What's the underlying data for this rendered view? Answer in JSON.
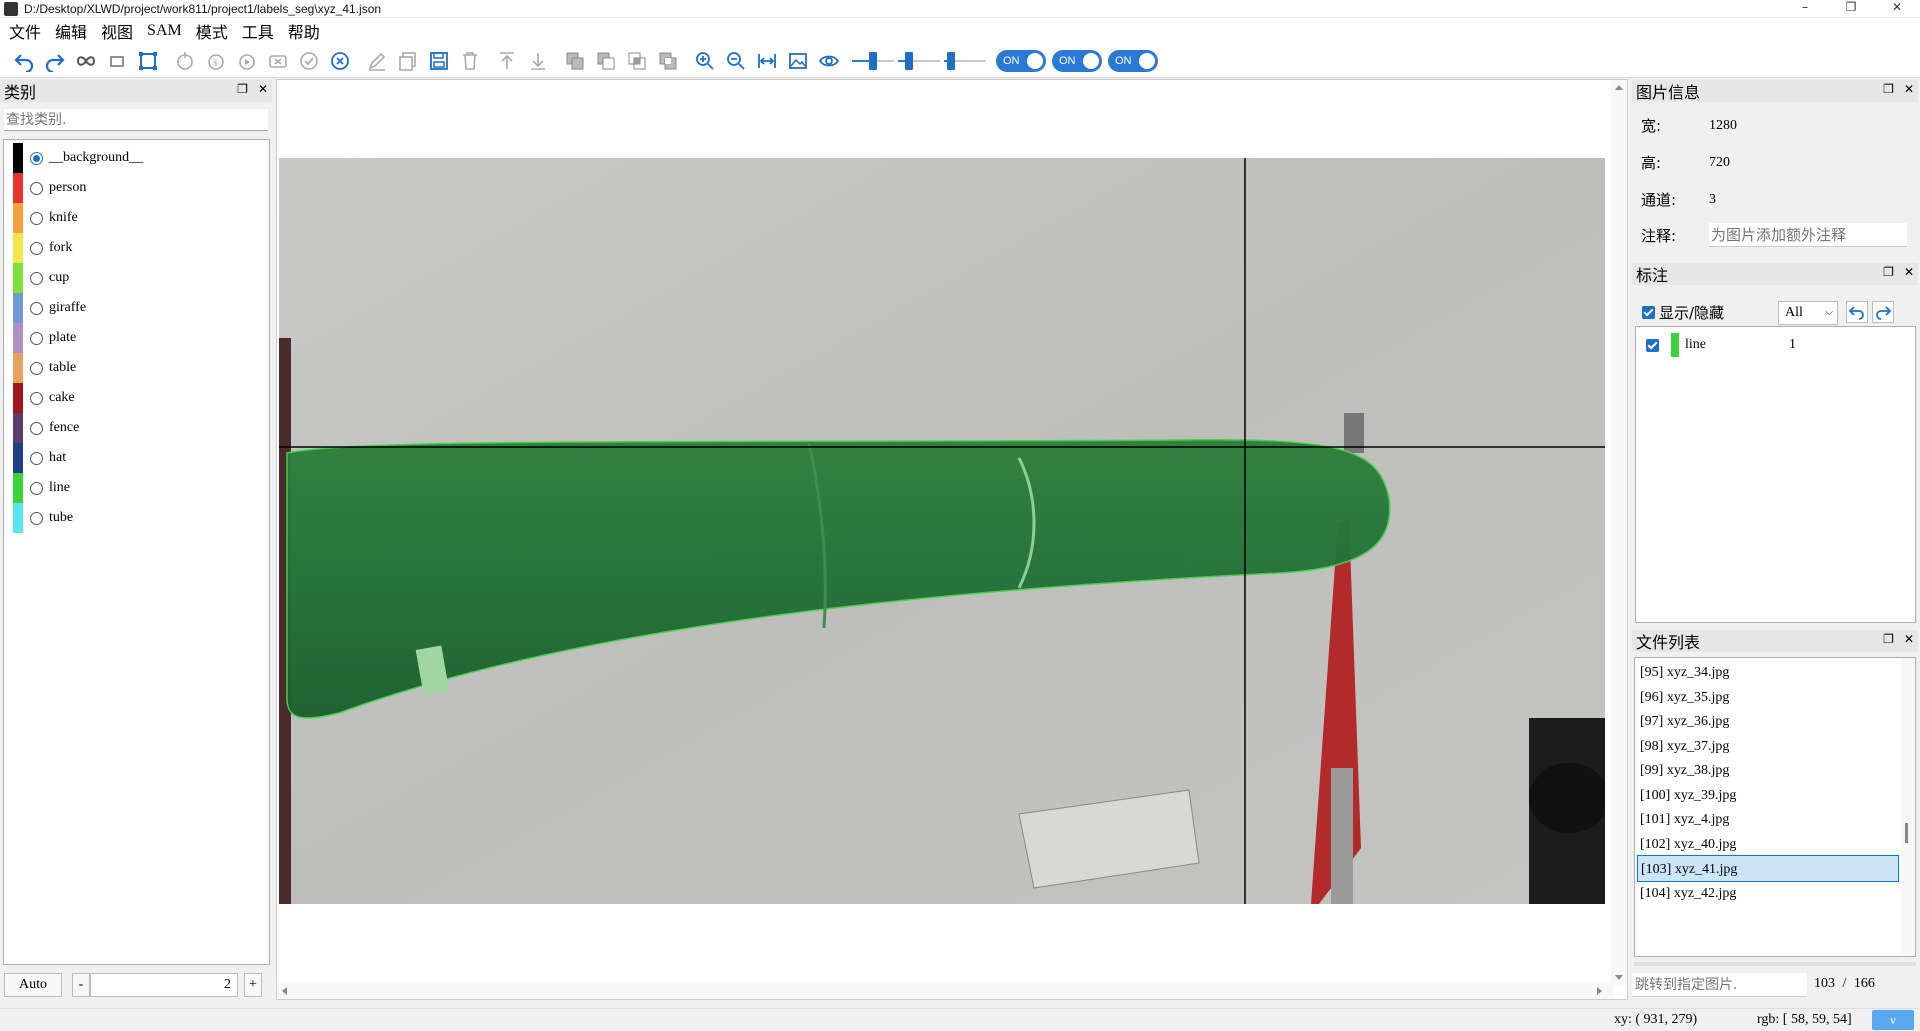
{
  "window": {
    "title": "D:/Desktop/XLWD/project/work811/project1/labels_seg\\xyz_41.json",
    "min": "–",
    "restore": "❐",
    "close": "✕"
  },
  "menu": [
    "文件",
    "编辑",
    "视图",
    "SAM",
    "模式",
    "工具",
    "帮助"
  ],
  "toolbar": {
    "toggles": [
      "ON",
      "ON",
      "ON"
    ],
    "sliders": [
      0.5,
      0.2,
      0.1
    ]
  },
  "categories_dock": {
    "title": "类别",
    "search_placeholder": "查找类别.",
    "items": [
      {
        "label": "__background__",
        "color": "#000000",
        "selected": true
      },
      {
        "label": "person",
        "color": "#e8322d"
      },
      {
        "label": "knife",
        "color": "#f2a13c"
      },
      {
        "label": "fork",
        "color": "#f7e64a"
      },
      {
        "label": "cup",
        "color": "#7ee03a"
      },
      {
        "label": "giraffe",
        "color": "#6f9ad6"
      },
      {
        "label": "plate",
        "color": "#b08fc4"
      },
      {
        "label": "table",
        "color": "#e7a25c"
      },
      {
        "label": "cake",
        "color": "#a3141c"
      },
      {
        "label": "fence",
        "color": "#5b3a6e"
      },
      {
        "label": "hat",
        "color": "#1f3f86"
      },
      {
        "label": "line",
        "color": "#3ad43a"
      },
      {
        "label": "tube",
        "color": "#58e6f2"
      }
    ],
    "auto_label": "Auto",
    "minus_label": "-",
    "plus_label": "+",
    "count_value": "2"
  },
  "image_info_dock": {
    "title": "图片信息",
    "width_label": "宽:",
    "width_value": "1280",
    "height_label": "高:",
    "height_value": "720",
    "channels_label": "通道:",
    "channels_value": "3",
    "note_label": "注释:",
    "note_placeholder": "为图片添加额外注释"
  },
  "annotation_dock": {
    "title": "标注",
    "show_hide_label": "显示/隐藏",
    "filter_value": "All",
    "items": [
      {
        "label": "line",
        "color": "#3ad43a",
        "count": "1"
      }
    ]
  },
  "file_dock": {
    "title": "文件列表",
    "files": [
      "[95] xyz_34.jpg",
      "[96] xyz_35.jpg",
      "[97] xyz_36.jpg",
      "[98] xyz_37.jpg",
      "[99] xyz_38.jpg",
      "[100] xyz_39.jpg",
      "[101] xyz_4.jpg",
      "[102] xyz_40.jpg",
      "[103] xyz_41.jpg",
      "[104] xyz_42.jpg"
    ],
    "selected_index": 8,
    "jump_placeholder": "跳转到指定图片.",
    "current": "103",
    "separator": "/",
    "total": "166"
  },
  "status": {
    "xy": "xy: ( 931, 279)",
    "rgb": "rgb: [ 58, 59, 54]",
    "badge": "v"
  }
}
